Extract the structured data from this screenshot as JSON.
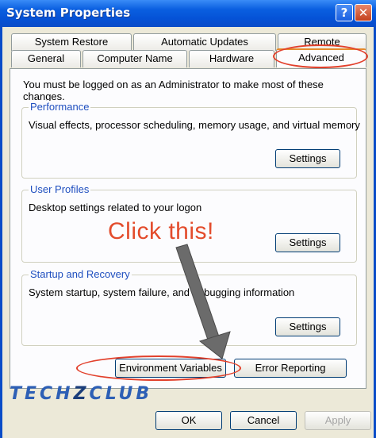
{
  "window": {
    "title": "System Properties",
    "help_glyph": "?",
    "close_glyph": "✕"
  },
  "tabs": {
    "row1": [
      "System Restore",
      "Automatic Updates",
      "Remote"
    ],
    "row2": [
      "General",
      "Computer Name",
      "Hardware",
      "Advanced"
    ],
    "active": "Advanced"
  },
  "advanced": {
    "intro": "You must be logged on as an Administrator to make most of these changes.",
    "performance": {
      "label": "Performance",
      "description": "Visual effects, processor scheduling, memory usage, and virtual memory",
      "button": "Settings"
    },
    "user_profiles": {
      "label": "User Profiles",
      "description": "Desktop settings related to your logon",
      "button": "Settings"
    },
    "startup_recovery": {
      "label": "Startup and Recovery",
      "description": "System startup, system failure, and debugging information",
      "button": "Settings"
    },
    "environment_variables": "Environment Variables",
    "error_reporting": "Error Reporting"
  },
  "footer": {
    "ok": "OK",
    "cancel": "Cancel",
    "apply": "Apply"
  },
  "annotation": {
    "text": "Click this!",
    "color": "#e34c2c"
  },
  "watermark": {
    "part1": "TECH",
    "part2": "Z",
    "part3": "CLUB"
  }
}
